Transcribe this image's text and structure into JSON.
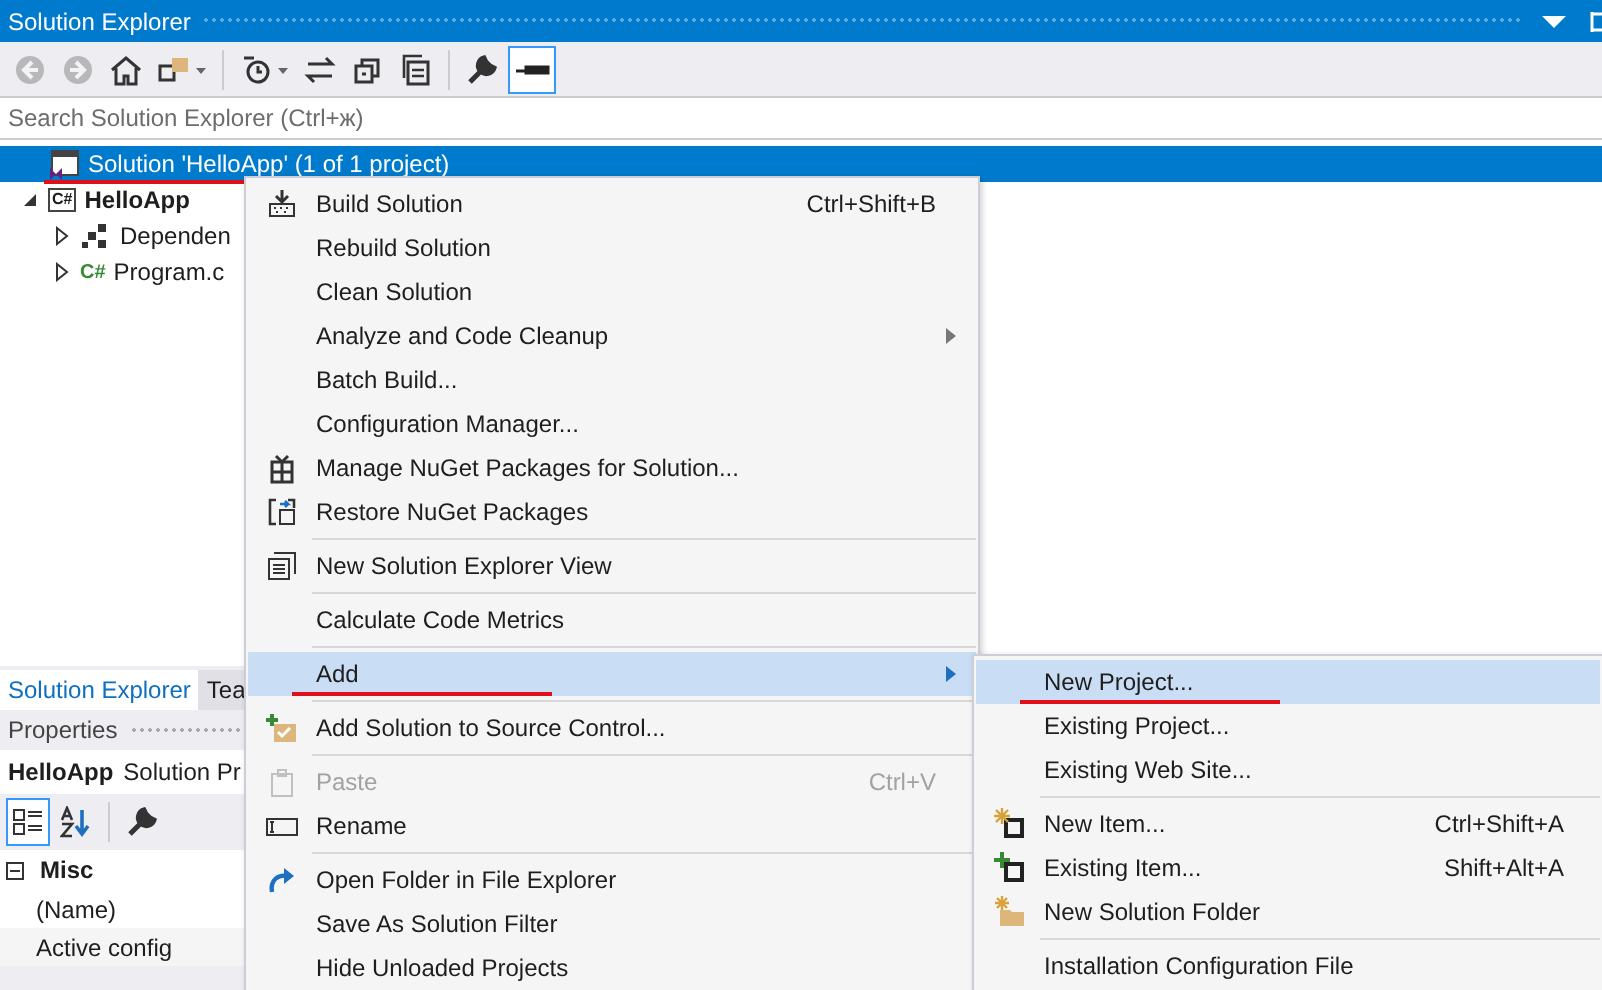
{
  "window": {
    "title": "Solution Explorer"
  },
  "toolbar": [
    {
      "kind": "back",
      "disabled": true,
      "selected": false
    },
    {
      "kind": "forward",
      "disabled": true,
      "selected": false
    },
    {
      "kind": "home",
      "disabled": false,
      "selected": false
    },
    {
      "kind": "switch-views",
      "disabled": false,
      "selected": false
    },
    {
      "kind": "pending",
      "disabled": false,
      "selected": false
    },
    {
      "kind": "sync",
      "disabled": false,
      "selected": false
    },
    {
      "kind": "collapse",
      "disabled": false,
      "selected": false
    },
    {
      "kind": "show-all",
      "disabled": false,
      "selected": false
    },
    {
      "kind": "properties",
      "disabled": false,
      "selected": false
    },
    {
      "kind": "preview",
      "disabled": false,
      "selected": true
    }
  ],
  "search": {
    "placeholder": "Search Solution Explorer (Ctrl+ж)"
  },
  "tree": [
    {
      "label": "Solution 'HelloApp' (1 of 1 project)",
      "kind": "solution",
      "selected": true,
      "marked": true,
      "children": [
        {
          "label": "HelloApp",
          "kind": "project",
          "icon_text": "C#",
          "selected": false,
          "marked": false,
          "expanded": true,
          "children": [
            {
              "label": "Dependen",
              "kind": "dependencies",
              "selected": false,
              "marked": false,
              "expanded": false
            },
            {
              "label": "Program.c",
              "kind": "file",
              "icon_text": "C#",
              "selected": false,
              "marked": false,
              "expanded": false
            }
          ]
        }
      ]
    }
  ],
  "bottom_tabs": [
    {
      "label": "Solution Explorer",
      "selected": true
    },
    {
      "label": "Tea",
      "selected": false
    }
  ],
  "properties": {
    "title": "Properties",
    "object_name": "HelloApp",
    "object_type": "Solution Pr",
    "toolbar": [
      {
        "kind": "categorized",
        "selected": true
      },
      {
        "kind": "alphabetical",
        "selected": false
      },
      {
        "kind": "property-pages",
        "selected": false
      }
    ],
    "category": {
      "label": "Misc",
      "expanded": true
    },
    "rows": [
      "(Name)",
      "Active config"
    ]
  },
  "context_menu": {
    "items": [
      {
        "kind": "item",
        "label": "Build Solution",
        "shortcut": "Ctrl+Shift+B",
        "disabled": false,
        "selected": false,
        "marked": false
      },
      {
        "kind": "item",
        "label": "Rebuild Solution",
        "disabled": false,
        "selected": false,
        "marked": false
      },
      {
        "kind": "item",
        "label": "Clean Solution",
        "disabled": false,
        "selected": false,
        "marked": false
      },
      {
        "kind": "submenu",
        "label": "Analyze and Code Cleanup",
        "disabled": false,
        "selected": false,
        "marked": false
      },
      {
        "kind": "item",
        "label": "Batch Build...",
        "disabled": false,
        "selected": false,
        "marked": false
      },
      {
        "kind": "item",
        "label": "Configuration Manager...",
        "disabled": false,
        "selected": false,
        "marked": false
      },
      {
        "kind": "item",
        "label": "Manage NuGet Packages for Solution...",
        "disabled": false,
        "selected": false,
        "marked": false
      },
      {
        "kind": "item",
        "label": "Restore NuGet Packages",
        "disabled": false,
        "selected": false,
        "marked": false
      },
      {
        "kind": "separator"
      },
      {
        "kind": "item",
        "label": "New Solution Explorer View",
        "disabled": false,
        "selected": false,
        "marked": false
      },
      {
        "kind": "separator"
      },
      {
        "kind": "item",
        "label": "Calculate Code Metrics",
        "disabled": false,
        "selected": false,
        "marked": false
      },
      {
        "kind": "separator"
      },
      {
        "kind": "submenu",
        "label": "Add",
        "disabled": false,
        "selected": true,
        "marked": true
      },
      {
        "kind": "separator"
      },
      {
        "kind": "item",
        "label": "Add Solution to Source Control...",
        "disabled": false,
        "selected": false,
        "marked": false
      },
      {
        "kind": "separator"
      },
      {
        "kind": "item",
        "label": "Paste",
        "shortcut": "Ctrl+V",
        "disabled": true,
        "selected": false,
        "marked": false
      },
      {
        "kind": "item",
        "label": "Rename",
        "disabled": false,
        "selected": false,
        "marked": false
      },
      {
        "kind": "separator"
      },
      {
        "kind": "item",
        "label": "Open Folder in File Explorer",
        "disabled": false,
        "selected": false,
        "marked": false
      },
      {
        "kind": "item",
        "label": "Save As Solution Filter",
        "disabled": false,
        "selected": false,
        "marked": false
      },
      {
        "kind": "item",
        "label": "Hide Unloaded Projects",
        "disabled": false,
        "selected": false,
        "marked": false
      }
    ]
  },
  "submenu": {
    "items": [
      {
        "kind": "item",
        "label": "New Project...",
        "disabled": false,
        "selected": true,
        "marked": true
      },
      {
        "kind": "item",
        "label": "Existing Project...",
        "disabled": false,
        "selected": false,
        "marked": false
      },
      {
        "kind": "item",
        "label": "Existing Web Site...",
        "disabled": false,
        "selected": false,
        "marked": false
      },
      {
        "kind": "separator"
      },
      {
        "kind": "item",
        "label": "New Item...",
        "shortcut": "Ctrl+Shift+A",
        "disabled": false,
        "selected": false,
        "marked": false
      },
      {
        "kind": "item",
        "label": "Existing Item...",
        "shortcut": "Shift+Alt+A",
        "disabled": false,
        "selected": false,
        "marked": false
      },
      {
        "kind": "item",
        "label": "New Solution Folder",
        "disabled": false,
        "selected": false,
        "marked": false
      },
      {
        "kind": "separator"
      },
      {
        "kind": "item",
        "label": "Installation Configuration File",
        "disabled": false,
        "selected": false,
        "marked": false
      }
    ]
  }
}
